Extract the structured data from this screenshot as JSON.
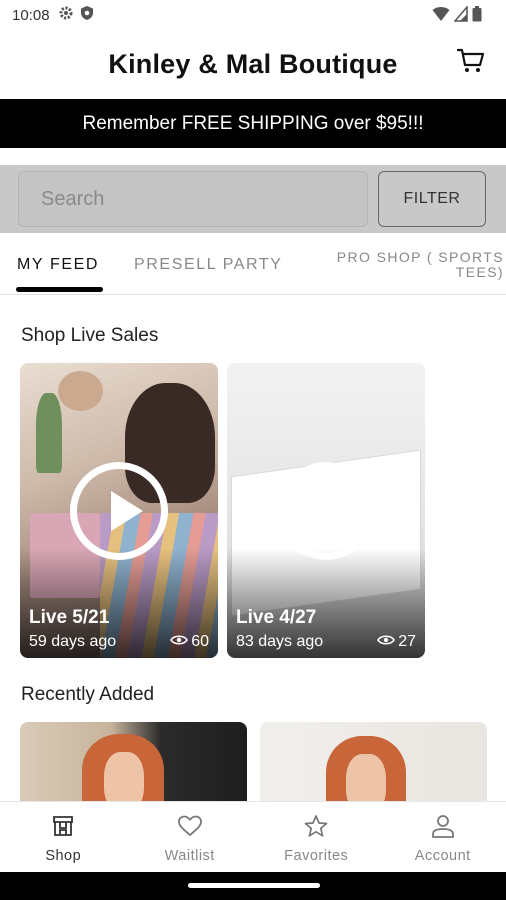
{
  "status_bar": {
    "time": "10:08",
    "icons": [
      "gear-icon",
      "shield-icon",
      "wifi-icon",
      "signal-icon",
      "battery-icon"
    ]
  },
  "header": {
    "title": "Kinley & Mal Boutique",
    "cart_icon": "cart-icon"
  },
  "promo_banner": {
    "text": "Remember FREE SHIPPING over $95!!!"
  },
  "search": {
    "placeholder": "Search",
    "value": "",
    "filter_label": "FILTER"
  },
  "tabs": [
    {
      "label": "MY FEED",
      "active": true
    },
    {
      "label": "PRESELL PARTY",
      "active": false
    },
    {
      "label_line1": "PRO SHOP ( SPORTS",
      "label_line2": "TEES)",
      "active": false
    }
  ],
  "live_sales": {
    "title": "Shop Live Sales",
    "items": [
      {
        "title": "Live 5/21",
        "ago": "59 days ago",
        "views": "60"
      },
      {
        "title": "Live 4/27",
        "ago": "83 days ago",
        "views": "27"
      }
    ]
  },
  "recently_added": {
    "title": "Recently Added"
  },
  "bottom_nav": [
    {
      "label": "Shop",
      "icon": "shop-icon",
      "active": true
    },
    {
      "label": "Waitlist",
      "icon": "heart-icon",
      "active": false
    },
    {
      "label": "Favorites",
      "icon": "star-icon",
      "active": false
    },
    {
      "label": "Account",
      "icon": "account-icon",
      "active": false
    }
  ],
  "colors": {
    "banner_bg": "#000000",
    "search_area_bg": "#c8c8c8",
    "active_text": "#111111",
    "inactive_text": "#888888"
  }
}
